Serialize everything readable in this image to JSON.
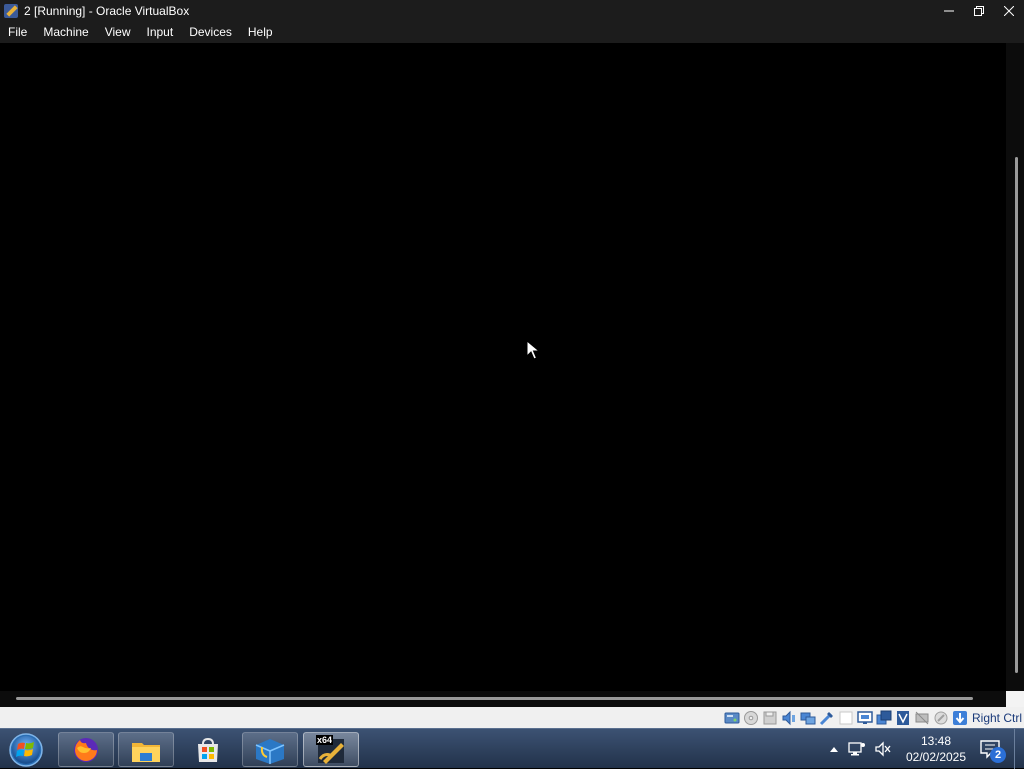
{
  "window": {
    "title": "2 [Running] - Oracle VirtualBox",
    "app_icon": "virtualbox-icon",
    "controls": [
      "minimize-icon",
      "restore-icon",
      "close-icon"
    ]
  },
  "menubar": {
    "items": [
      "File",
      "Machine",
      "View",
      "Input",
      "Devices",
      "Help"
    ]
  },
  "statusbar": {
    "icons": [
      "hard-disk-icon",
      "optical-drive-icon",
      "floppy-icon",
      "audio-icon",
      "network-icon",
      "usb-icon",
      "shared-folders-icon",
      "display-icon",
      "video-capture-icon",
      "vrde-icon",
      "cpu-icon",
      "mouse-integration-icon",
      "keyboard-icon"
    ],
    "host_key": "Right Ctrl"
  },
  "taskbar": {
    "apps": [
      "firefox-icon",
      "file-explorer-icon",
      "microsoft-store-icon",
      "virtualbox-manager-icon",
      "virtualbox-vm-icon"
    ],
    "vm_icon_label": "x64",
    "clock": {
      "time": "13:48",
      "date": "02/02/2025"
    },
    "notifications_count": "2"
  },
  "colors": {
    "titlebar_bg": "#1c1c1c",
    "vm_screen_bg": "#000000",
    "statusbar_bg": "#f0f0f0",
    "taskbar_bg": "#2c3e5c",
    "host_key_text": "#1a3a7a"
  }
}
